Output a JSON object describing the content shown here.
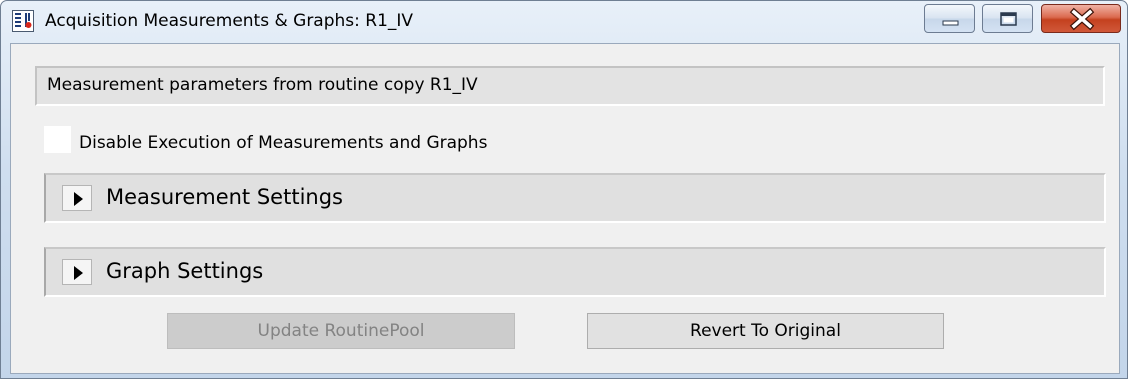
{
  "window": {
    "title": "Acquisition Measurements & Graphs: R1_IV",
    "app_icon": "settings-sliders-icon"
  },
  "controls": {
    "minimize_icon": "minimize-icon",
    "maximize_icon": "maximize-icon",
    "close_icon": "close-icon"
  },
  "info": {
    "text": "Measurement parameters from routine copy R1_IV"
  },
  "disable_execution": {
    "label": "Disable Execution of Measurements and Graphs",
    "checked": false
  },
  "sections": [
    {
      "label": "Measurement Settings",
      "expanded": false,
      "icon": "expand-triangle-icon"
    },
    {
      "label": "Graph Settings",
      "expanded": false,
      "icon": "expand-triangle-icon"
    }
  ],
  "buttons": {
    "update_label": "Update RoutinePool",
    "update_enabled": false,
    "revert_label": "Revert To Original"
  },
  "colors": {
    "close_button": "#c4411f",
    "title_gradient": "#cfdeef",
    "disabled_text": "#838383"
  }
}
